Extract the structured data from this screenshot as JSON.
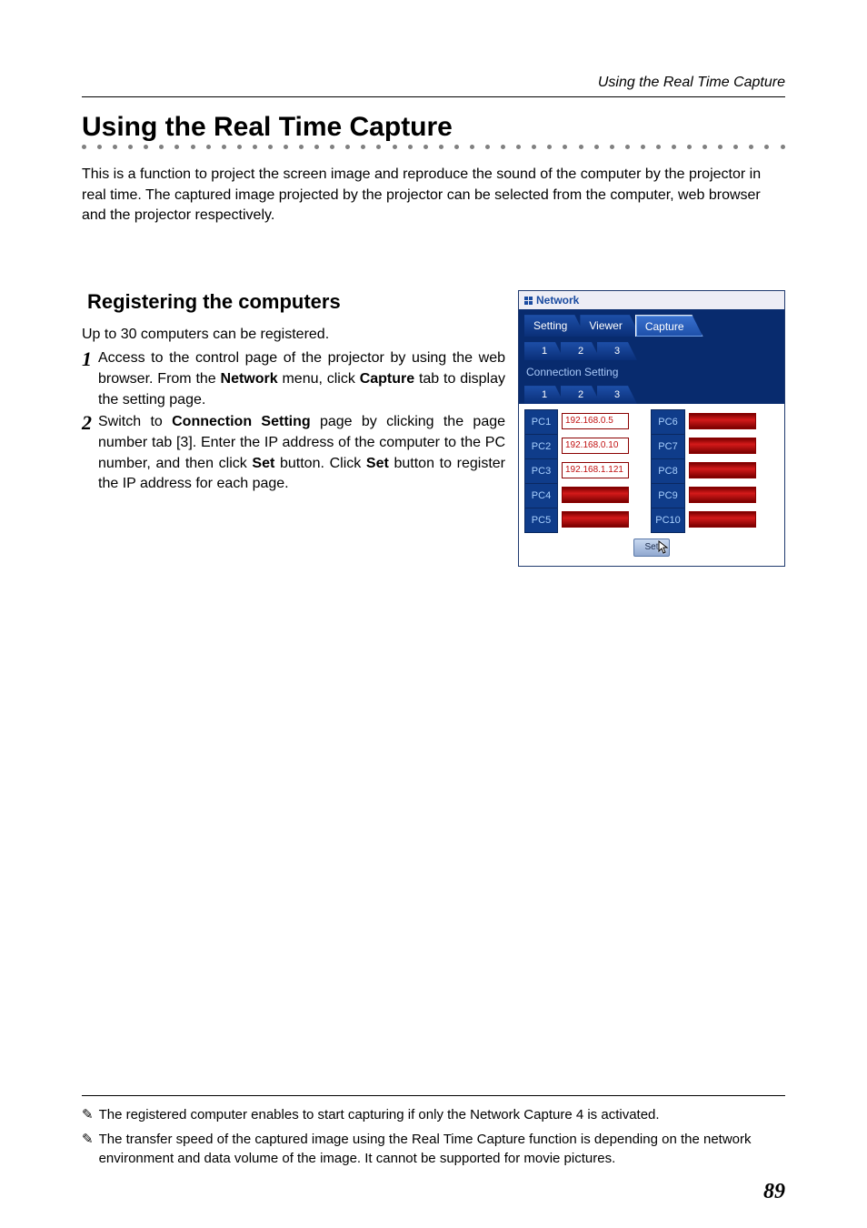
{
  "header": {
    "running_title": "Using the Real Time Capture"
  },
  "title": "Using the Real Time Capture",
  "intro": "This is a function to project the screen image  and  reproduce the sound of the  computer by the projector in real time. The captured image projected by the projector can be selected from the computer, web browser and the projector respectively.",
  "section_heading": "Registering the computers",
  "reg_line": "Up to 30 computers can be registered.",
  "steps": {
    "s1_num": "1",
    "s1_a": "Access to the control page of the projector by using the web browser. From the ",
    "s1_b": "Network",
    "s1_c": " menu, click ",
    "s1_d": "Capture",
    "s1_e": " tab to display the setting page.",
    "s2_num": "2",
    "s2_a": "Switch to ",
    "s2_b": "Connection Setting",
    "s2_c": " page by clicking the  page number tab [3]. Enter the IP address of the computer to the PC number, and then click ",
    "s2_d": "Set",
    "s2_e": " button. Click ",
    "s2_f": "Set",
    "s2_g": " button to register the IP address for each page."
  },
  "figure": {
    "window_title": "Network",
    "tabs": {
      "t1": "Setting",
      "t2": "Viewer",
      "t3": "Capture"
    },
    "subtabs": {
      "a": "1",
      "b": "2",
      "c": "3"
    },
    "cs_label": "Connection Setting",
    "cs_subtabs": {
      "a": "1",
      "b": "2",
      "c": "3"
    },
    "rows": [
      {
        "left_label": "PC1",
        "left_value": "192.168.0.5",
        "right_label": "PC6",
        "right_value": ""
      },
      {
        "left_label": "PC2",
        "left_value": "192.168.0.10",
        "right_label": "PC7",
        "right_value": ""
      },
      {
        "left_label": "PC3",
        "left_value": "192.168.1.121",
        "right_label": "PC8",
        "right_value": ""
      },
      {
        "left_label": "PC4",
        "left_value": "",
        "right_label": "PC9",
        "right_value": ""
      },
      {
        "left_label": "PC5",
        "left_value": "",
        "right_label": "PC10",
        "right_value": ""
      }
    ],
    "set_label": "Set"
  },
  "footnotes": {
    "mark": "✎",
    "f1": "The registered computer enables to start capturing if only the Network Capture 4 is activated.",
    "f2": "The transfer speed of the captured image using the Real Time Capture function is depending on the network environment and data volume of the image. It cannot be supported for movie pictures."
  },
  "page_number": "89"
}
